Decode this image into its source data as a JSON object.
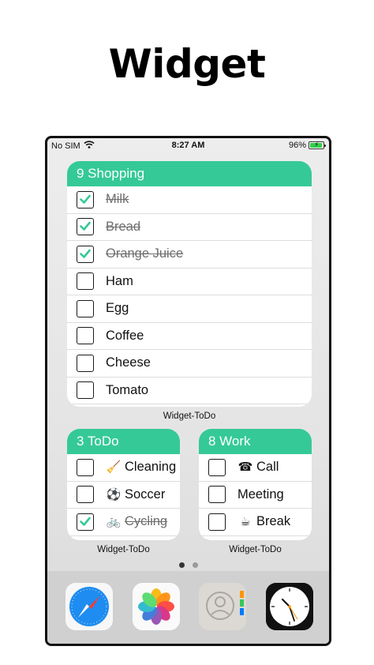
{
  "header": {
    "title": "Widget"
  },
  "status_bar": {
    "carrier": "No SIM",
    "time": "8:27 AM",
    "battery": "96%",
    "battery_level": 0.96
  },
  "shopping_widget": {
    "title": "9 Shopping",
    "caption": "Widget-ToDo",
    "items": [
      {
        "label": "Milk",
        "done": true
      },
      {
        "label": "Bread",
        "done": true
      },
      {
        "label": "Orange Juice",
        "done": true
      },
      {
        "label": "Ham",
        "done": false
      },
      {
        "label": "Egg",
        "done": false
      },
      {
        "label": "Coffee",
        "done": false
      },
      {
        "label": "Cheese",
        "done": false
      },
      {
        "label": "Tomato",
        "done": false
      }
    ]
  },
  "todo_widget": {
    "title": "3 ToDo",
    "caption": "Widget-ToDo",
    "items": [
      {
        "emoji": "🧹",
        "label": "Cleaning",
        "done": false
      },
      {
        "emoji": "⚽",
        "label": "Soccer",
        "done": false
      },
      {
        "emoji": "🚲",
        "label": "Cycling",
        "done": true
      }
    ]
  },
  "work_widget": {
    "title": "8 Work",
    "caption": "Widget-ToDo",
    "items": [
      {
        "emoji": "☎",
        "label": "Call",
        "done": false
      },
      {
        "emoji": "",
        "label": "Meeting",
        "done": false
      },
      {
        "emoji": "☕",
        "label": "Break",
        "done": false
      }
    ]
  },
  "page_indicator": {
    "count": 2,
    "current": 1
  },
  "dock": {
    "apps": [
      {
        "icon": "safari-icon"
      },
      {
        "icon": "photos-icon"
      },
      {
        "icon": "contacts-icon"
      },
      {
        "icon": "clock-icon"
      }
    ]
  },
  "colors": {
    "accent": "#35c998",
    "check": "#35c998"
  }
}
